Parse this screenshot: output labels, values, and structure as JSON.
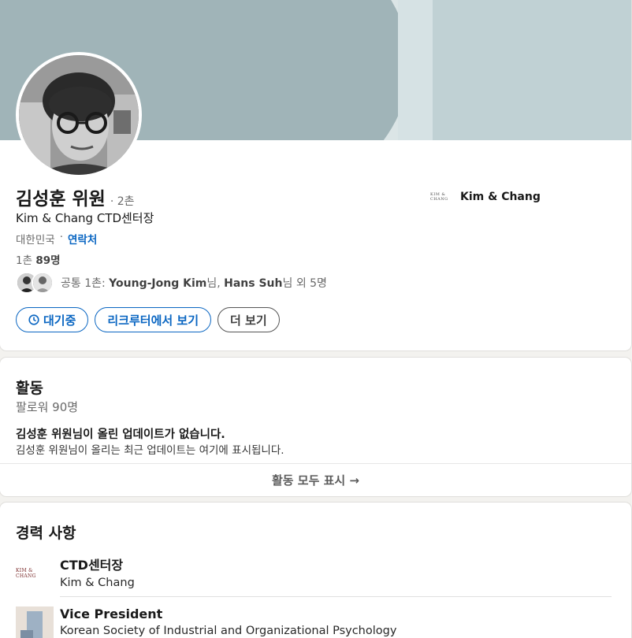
{
  "profile": {
    "name": "김성훈 위원",
    "degree": "· 2촌",
    "headline": "Kim & Chang CTD센터장",
    "location": "대한민국",
    "location_sep": "·",
    "contact_label": "연락처",
    "connections_prefix": "1촌",
    "connections_count": "89명",
    "mutual": {
      "prefix": "공통 1촌: ",
      "name1": "Young-Jong Kim",
      "suffix1": "님, ",
      "name2": "Hans Suh",
      "suffix2": "님 외 5명"
    },
    "buttons": {
      "pending": "대기중",
      "recruiter": "리크루터에서 보기",
      "more": "더 보기"
    },
    "current_company": {
      "logo_text": "KIM & CHANG",
      "name": "Kim & Chang"
    }
  },
  "activity": {
    "title": "활동",
    "followers": "팔로워 90명",
    "empty_title": "김성훈 위원님이 올린 업데이트가 없습니다.",
    "empty_desc": "김성훈 위원님이 올리는 최근 업데이트는 여기에 표시됩니다.",
    "show_all": "활동 모두 표시 →"
  },
  "experience": {
    "title": "경력 사항",
    "items": [
      {
        "logo_text": "KIM & CHANG",
        "title": "CTD센터장",
        "company": "Kim & Chang"
      },
      {
        "title": "Vice President",
        "company": "Korean Society of Industrial and Organizational Psychology"
      }
    ]
  },
  "colors": {
    "accent": "#0a66c2",
    "banner": "#c0d1d4",
    "banner_shape": "#a0b4b8"
  }
}
